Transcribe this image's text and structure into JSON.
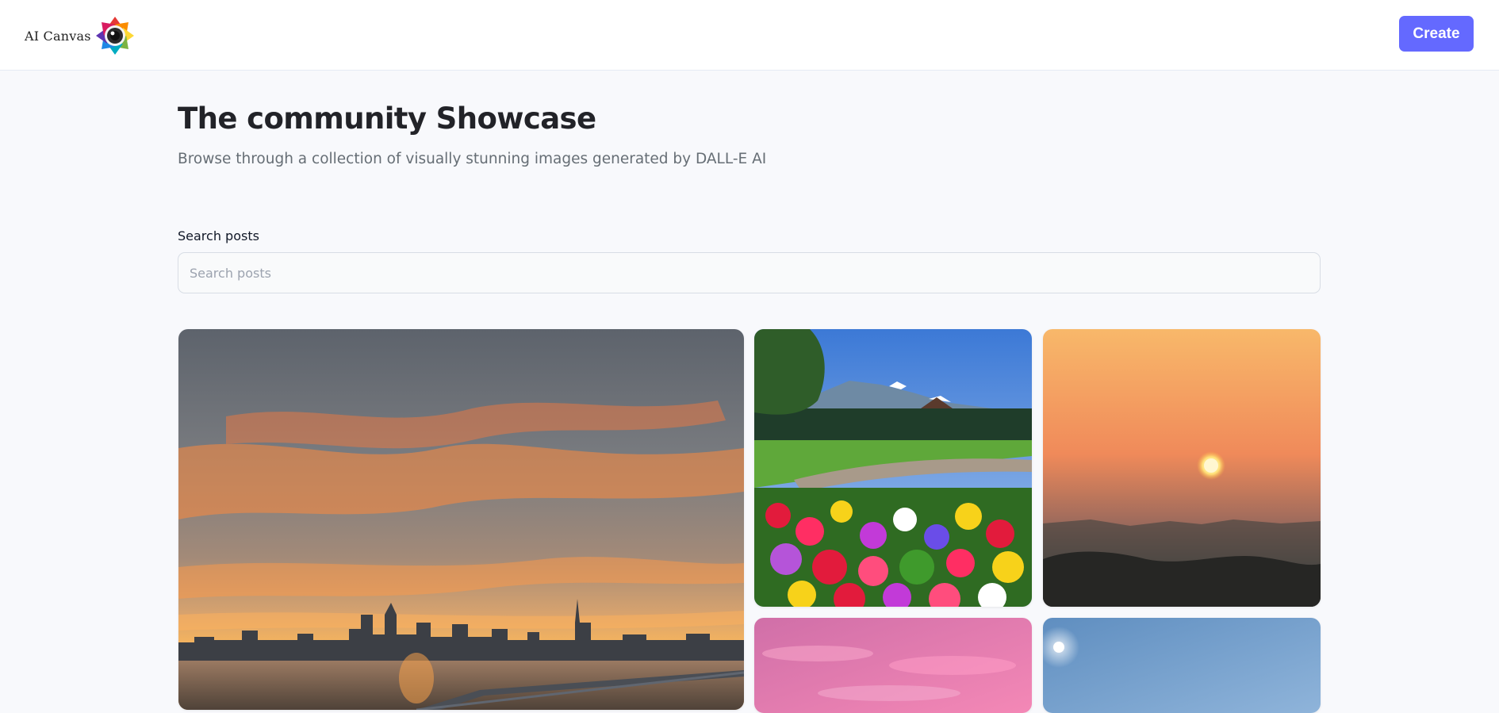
{
  "header": {
    "logo_text": "AI Canvas",
    "create_label": "Create",
    "accent_color": "#6469ff"
  },
  "main": {
    "title": "The community Showcase",
    "subtitle": "Browse through a collection of visually stunning images generated by DALL-E AI"
  },
  "search": {
    "label": "Search posts",
    "placeholder": "Search posts",
    "value": ""
  },
  "gallery": {
    "cards": [
      {
        "subject": "sunset-city-skyline-waterfront"
      },
      {
        "subject": "flower-garden-mountains"
      },
      {
        "subject": "hazy-orange-sunset"
      },
      {
        "subject": "pink-clouds-sky"
      },
      {
        "subject": "blue-sky-sun"
      }
    ]
  }
}
